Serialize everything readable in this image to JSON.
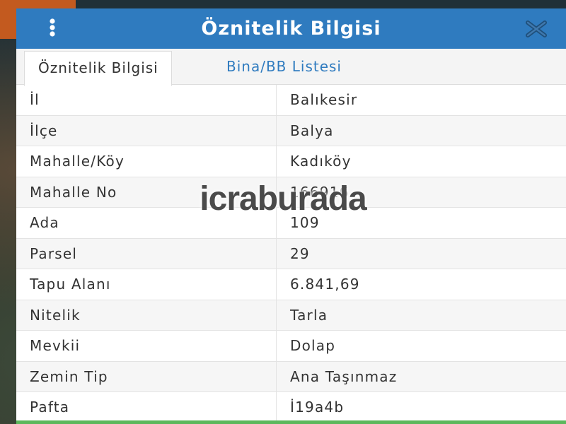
{
  "panel": {
    "title": "Öznitelik Bilgisi",
    "menu_icon": "vertical-dots-icon",
    "close_icon": "close-x-icon"
  },
  "tabs": [
    {
      "label": "Öznitelik Bilgisi",
      "active": true
    },
    {
      "label": "Bina/BB Listesi",
      "active": false
    }
  ],
  "rows": [
    {
      "key": "İl",
      "value": "Balıkesir"
    },
    {
      "key": "İlçe",
      "value": "Balya"
    },
    {
      "key": "Mahalle/Köy",
      "value": "Kadıköy"
    },
    {
      "key": "Mahalle No",
      "value": "166916"
    },
    {
      "key": "Ada",
      "value": "109"
    },
    {
      "key": "Parsel",
      "value": "29"
    },
    {
      "key": "Tapu Alanı",
      "value": "6.841,69"
    },
    {
      "key": "Nitelik",
      "value": "Tarla"
    },
    {
      "key": "Mevkii",
      "value": "Dolap"
    },
    {
      "key": "Zemin Tip",
      "value": "Ana Taşınmaz"
    },
    {
      "key": "Pafta",
      "value": "İ19a4b"
    }
  ],
  "watermark": "icraburada",
  "colors": {
    "header": "#2f7bbf",
    "tab_link": "#2f7bbf",
    "bottom_bar": "#5cb85c",
    "background_accent": "#c35a1f"
  }
}
